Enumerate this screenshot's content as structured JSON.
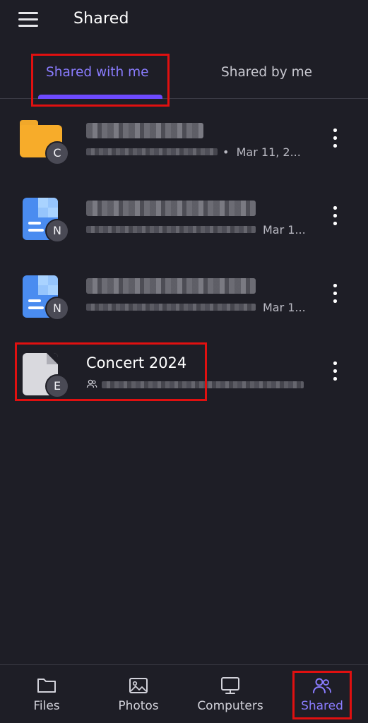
{
  "header": {
    "title": "Shared",
    "menu_icon": "hamburger-menu-icon"
  },
  "tabs": [
    {
      "label": "Shared with me",
      "active": true
    },
    {
      "label": "Shared by me",
      "active": false
    }
  ],
  "items": [
    {
      "type": "folder",
      "title": "",
      "avatar": "C",
      "date": "Mar 11, 2...",
      "shared_icon": false
    },
    {
      "type": "document",
      "title": "",
      "avatar": "N",
      "date": "Mar 1...",
      "shared_icon": false
    },
    {
      "type": "document",
      "title": "",
      "avatar": "N",
      "date": "Mar 1...",
      "shared_icon": false
    },
    {
      "type": "file",
      "title": "Concert 2024",
      "avatar": "E",
      "date": "",
      "shared_icon": true
    }
  ],
  "bottom_nav": [
    {
      "label": "Files",
      "icon": "folder-icon",
      "active": false
    },
    {
      "label": "Photos",
      "icon": "image-icon",
      "active": false
    },
    {
      "label": "Computers",
      "icon": "monitor-icon",
      "active": false
    },
    {
      "label": "Shared",
      "icon": "people-icon",
      "active": true
    }
  ],
  "colors": {
    "background": "#1e1e26",
    "accent": "#6d4aff",
    "accent_text": "#8a7cff",
    "highlight": "#e01010",
    "folder": "#f7ac2a"
  }
}
